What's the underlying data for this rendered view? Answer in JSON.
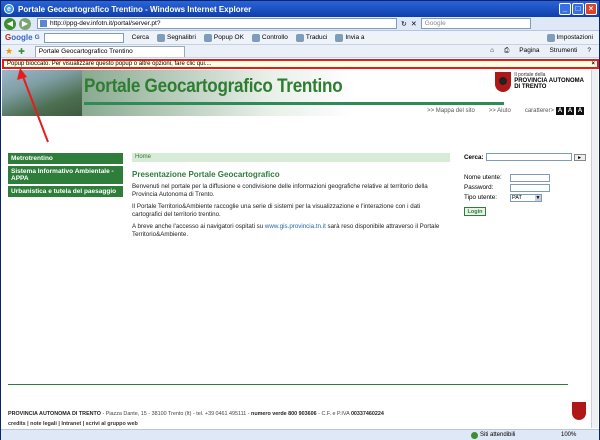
{
  "window": {
    "title": "Portale Geocartografico Trentino - Windows Internet Explorer",
    "ie_glyph": "e",
    "ctrl_min": "_",
    "ctrl_max": "□",
    "ctrl_close": "×"
  },
  "address": {
    "back_glyph": "◀",
    "forward_glyph": "▶",
    "url": "http://ppg-dev.infotn.it/portal/server.pt?",
    "stop_glyph": "✕",
    "refresh_glyph": "↻",
    "search_placeholder": "Google"
  },
  "google_bar": {
    "logo_g": "G",
    "logo_rest": "oogle",
    "logo_c": "G",
    "search_label": "Cerca",
    "bookmarks": "Segnalibri",
    "popup": "Popup OK",
    "check": "Controllo",
    "translate": "Traduci",
    "send": "Invia a",
    "settings": "Impostazioni"
  },
  "tabs": {
    "fav_star": "★",
    "add_fav": "✚",
    "active": "Portale Geocartografico Trentino",
    "home": "⌂",
    "print": "⎙",
    "page": "Pagina",
    "tools": "Strumenti",
    "help": "?"
  },
  "infobar": {
    "message": "Popup bloccato. Per visualizzare questo popup o altre opzioni, fare clic qui....",
    "close": "×"
  },
  "page": {
    "site_title": "Portale Geocartografico Trentino",
    "prov_small": "Il portale della",
    "prov_name1": "PROVINCIA AUTONOMA",
    "prov_name2": "DI TRENTO",
    "link_map": ">> Mappa del sito",
    "link_help": ">> Aiuto",
    "font_label": "caratterer>",
    "font_a1": "A",
    "font_a2": "A",
    "font_a3": "A",
    "nav": [
      "Metrotrentino",
      "Sistema Informativo Ambientale - APPA",
      "Urbanistica e tutela del paesaggio"
    ],
    "breadcrumb": "Home",
    "heading": "Presentazione Portale Geocartografico",
    "p1": "Benvenuti nel portale per la diffusione e condivisione delle informazioni geografiche relative al territorio della Provincia Autonoma di Trento.",
    "p2": "Il Portale Territorio&Ambiente raccoglie una serie di sistemi per la visualizzazione e l'interazione con i dati cartografici del territorio trentino.",
    "p3_pre": "A breve anche l'accesso ai navigatori ospitati su ",
    "p3_link": "www.gis.provincia.tn.it",
    "p3_post": " sarà reso disponibile attraverso il Portale Territorio&Ambiente.",
    "search_label": "Cerca:",
    "search_go": "►",
    "login": {
      "user_label": "Nome utente:",
      "pass_label": "Password:",
      "type_label": "Tipo utente:",
      "type_value": "PAT",
      "type_arrow": "▼",
      "button": "Login"
    },
    "footer_addr_name": "PROVINCIA AUTONOMA DI TRENTO",
    "footer_addr": " - Piazza Dante, 15 - 38100 Trento (It) - tel. +39 0461 495111 - ",
    "footer_numero": "numero verde 800 903606",
    "footer_cf": " - C.F. e P.IVA ",
    "footer_piva": "00337460224",
    "footer_links": "credits | note legali | Intranet | scrivi al gruppo web"
  },
  "status": {
    "zone": "Siti attendibili",
    "zoom": "100%"
  },
  "colors": {
    "accent_green": "#2e7d3a",
    "infobar_border": "#e81c1c",
    "titlebar": "#0f3fa8"
  }
}
